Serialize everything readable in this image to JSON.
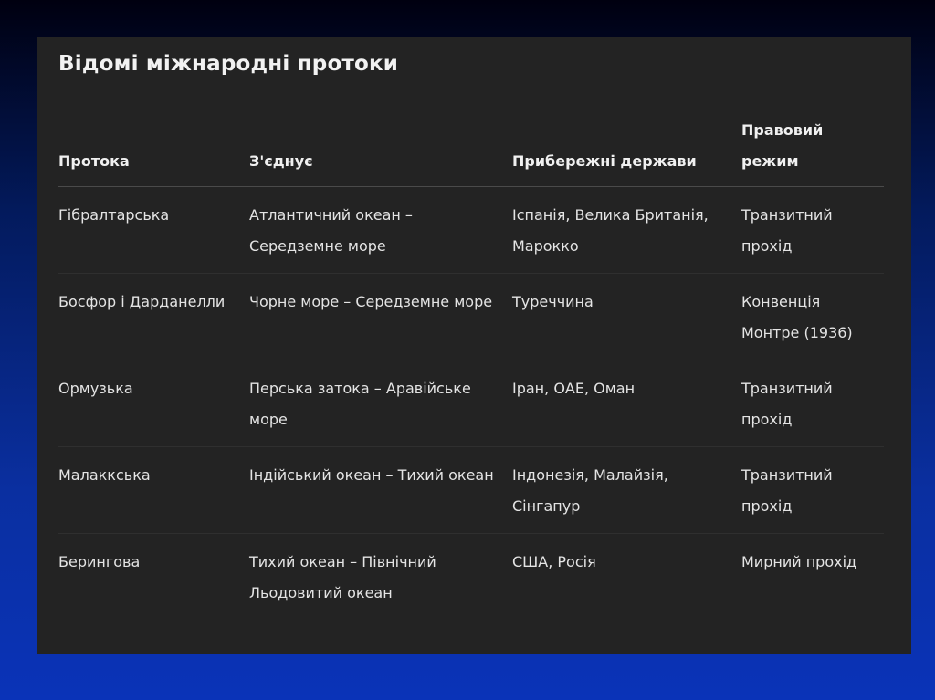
{
  "slide": {
    "title": "Відомі міжнародні протоки"
  },
  "table": {
    "headers": [
      "Протока",
      "З'єднує",
      "Прибережні держави",
      "Правовий режим"
    ],
    "rows": [
      [
        "Гібралтарська",
        "Атлантичний океан – Середземне море",
        "Іспанія, Велика Британія, Марокко",
        "Транзитний прохід"
      ],
      [
        "Босфор і Дарданелли",
        "Чорне море – Середземне море",
        "Туреччина",
        "Конвенція Монтре (1936)"
      ],
      [
        "Ормузька",
        "Перська затока – Аравійське море",
        "Іран, ОАЕ, Оман",
        "Транзитний прохід"
      ],
      [
        "Малаккська",
        "Індійський океан – Тихий океан",
        "Індонезія, Малайзія, Сінгапур",
        "Транзитний прохід"
      ],
      [
        "Берингова",
        "Тихий океан – Північний Льодовитий океан",
        "США, Росія",
        "Мирний прохід"
      ]
    ]
  },
  "colors": {
    "panel_background": "#232323",
    "slide_background": "#0a2fa0",
    "text": "#e9e9e9"
  }
}
